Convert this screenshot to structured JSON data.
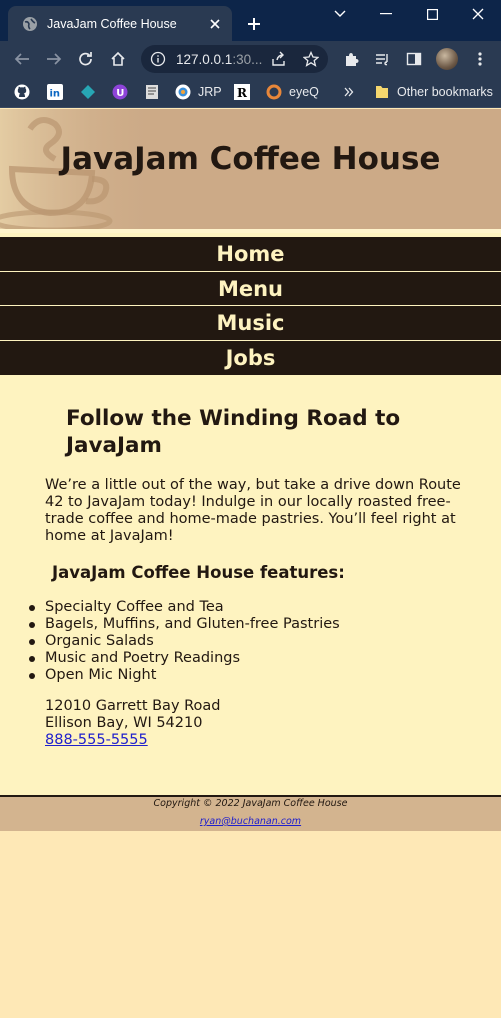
{
  "browser": {
    "tab_title": "JavaJam Coffee House",
    "url_host": "127.0.0.1",
    "url_rest": ":30...",
    "bookmarks": [
      {
        "icon": "github-icon",
        "label": ""
      },
      {
        "icon": "linkedin-icon",
        "label": ""
      },
      {
        "icon": "diamond-icon",
        "label": ""
      },
      {
        "icon": "shield-u-icon",
        "label": ""
      },
      {
        "icon": "document-icon",
        "label": ""
      },
      {
        "icon": "jrp-icon",
        "label": "JRP"
      },
      {
        "icon": "r-logo-icon",
        "label": ""
      },
      {
        "icon": "eyeq-icon",
        "label": "eyeQ"
      }
    ],
    "other_bookmarks": "Other bookmarks",
    "colors": {
      "tabbar": "#0D2549",
      "toolbar": "#2A3A52"
    }
  },
  "site": {
    "title": "JavaJam Coffee House",
    "nav": [
      "Home",
      "Menu",
      "Music",
      "Jobs"
    ],
    "heading": "Follow the Winding Road to JavaJam",
    "intro": "We’re a little out of the way, but take a drive down Route 42 to JavaJam today! Indulge in our locally roasted free-trade coffee and home-made pastries. You’ll feel right at home at JavaJam!",
    "features_heading": "JavaJam Coffee House features:",
    "features": [
      "Specialty Coffee and Tea",
      "Bagels, Muffins, and Gluten-free Pastries",
      "Organic Salads",
      "Music and Poetry Readings",
      "Open Mic Night"
    ],
    "address_line1": "12010 Garrett Bay Road",
    "address_line2": "Ellison Bay, WI 54210",
    "phone": "888-555-5555",
    "copyright": "Copyright © 2022 JavaJam Coffee House",
    "email": "ryan@buchanan.com",
    "colors": {
      "dark": "#221811",
      "cream": "#FEF3C0",
      "header": "#CCAA87",
      "footer": "#D3B48F",
      "background": "#FEE8B6"
    }
  }
}
